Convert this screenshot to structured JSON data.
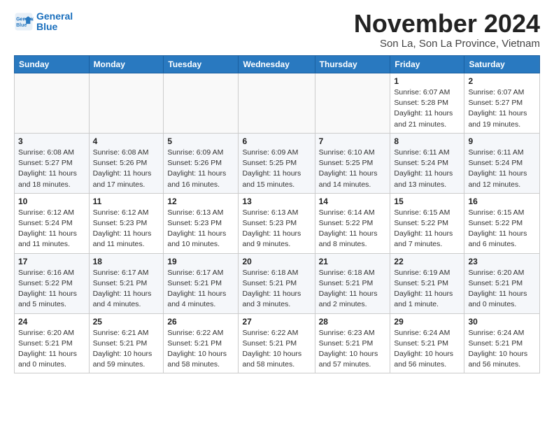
{
  "logo": {
    "line1": "General",
    "line2": "Blue"
  },
  "header": {
    "month": "November 2024",
    "location": "Son La, Son La Province, Vietnam"
  },
  "weekdays": [
    "Sunday",
    "Monday",
    "Tuesday",
    "Wednesday",
    "Thursday",
    "Friday",
    "Saturday"
  ],
  "weeks": [
    [
      {
        "day": "",
        "detail": ""
      },
      {
        "day": "",
        "detail": ""
      },
      {
        "day": "",
        "detail": ""
      },
      {
        "day": "",
        "detail": ""
      },
      {
        "day": "",
        "detail": ""
      },
      {
        "day": "1",
        "detail": "Sunrise: 6:07 AM\nSunset: 5:28 PM\nDaylight: 11 hours and 21 minutes."
      },
      {
        "day": "2",
        "detail": "Sunrise: 6:07 AM\nSunset: 5:27 PM\nDaylight: 11 hours and 19 minutes."
      }
    ],
    [
      {
        "day": "3",
        "detail": "Sunrise: 6:08 AM\nSunset: 5:27 PM\nDaylight: 11 hours and 18 minutes."
      },
      {
        "day": "4",
        "detail": "Sunrise: 6:08 AM\nSunset: 5:26 PM\nDaylight: 11 hours and 17 minutes."
      },
      {
        "day": "5",
        "detail": "Sunrise: 6:09 AM\nSunset: 5:26 PM\nDaylight: 11 hours and 16 minutes."
      },
      {
        "day": "6",
        "detail": "Sunrise: 6:09 AM\nSunset: 5:25 PM\nDaylight: 11 hours and 15 minutes."
      },
      {
        "day": "7",
        "detail": "Sunrise: 6:10 AM\nSunset: 5:25 PM\nDaylight: 11 hours and 14 minutes."
      },
      {
        "day": "8",
        "detail": "Sunrise: 6:11 AM\nSunset: 5:24 PM\nDaylight: 11 hours and 13 minutes."
      },
      {
        "day": "9",
        "detail": "Sunrise: 6:11 AM\nSunset: 5:24 PM\nDaylight: 11 hours and 12 minutes."
      }
    ],
    [
      {
        "day": "10",
        "detail": "Sunrise: 6:12 AM\nSunset: 5:24 PM\nDaylight: 11 hours and 11 minutes."
      },
      {
        "day": "11",
        "detail": "Sunrise: 6:12 AM\nSunset: 5:23 PM\nDaylight: 11 hours and 11 minutes."
      },
      {
        "day": "12",
        "detail": "Sunrise: 6:13 AM\nSunset: 5:23 PM\nDaylight: 11 hours and 10 minutes."
      },
      {
        "day": "13",
        "detail": "Sunrise: 6:13 AM\nSunset: 5:23 PM\nDaylight: 11 hours and 9 minutes."
      },
      {
        "day": "14",
        "detail": "Sunrise: 6:14 AM\nSunset: 5:22 PM\nDaylight: 11 hours and 8 minutes."
      },
      {
        "day": "15",
        "detail": "Sunrise: 6:15 AM\nSunset: 5:22 PM\nDaylight: 11 hours and 7 minutes."
      },
      {
        "day": "16",
        "detail": "Sunrise: 6:15 AM\nSunset: 5:22 PM\nDaylight: 11 hours and 6 minutes."
      }
    ],
    [
      {
        "day": "17",
        "detail": "Sunrise: 6:16 AM\nSunset: 5:22 PM\nDaylight: 11 hours and 5 minutes."
      },
      {
        "day": "18",
        "detail": "Sunrise: 6:17 AM\nSunset: 5:21 PM\nDaylight: 11 hours and 4 minutes."
      },
      {
        "day": "19",
        "detail": "Sunrise: 6:17 AM\nSunset: 5:21 PM\nDaylight: 11 hours and 4 minutes."
      },
      {
        "day": "20",
        "detail": "Sunrise: 6:18 AM\nSunset: 5:21 PM\nDaylight: 11 hours and 3 minutes."
      },
      {
        "day": "21",
        "detail": "Sunrise: 6:18 AM\nSunset: 5:21 PM\nDaylight: 11 hours and 2 minutes."
      },
      {
        "day": "22",
        "detail": "Sunrise: 6:19 AM\nSunset: 5:21 PM\nDaylight: 11 hours and 1 minute."
      },
      {
        "day": "23",
        "detail": "Sunrise: 6:20 AM\nSunset: 5:21 PM\nDaylight: 11 hours and 0 minutes."
      }
    ],
    [
      {
        "day": "24",
        "detail": "Sunrise: 6:20 AM\nSunset: 5:21 PM\nDaylight: 11 hours and 0 minutes."
      },
      {
        "day": "25",
        "detail": "Sunrise: 6:21 AM\nSunset: 5:21 PM\nDaylight: 10 hours and 59 minutes."
      },
      {
        "day": "26",
        "detail": "Sunrise: 6:22 AM\nSunset: 5:21 PM\nDaylight: 10 hours and 58 minutes."
      },
      {
        "day": "27",
        "detail": "Sunrise: 6:22 AM\nSunset: 5:21 PM\nDaylight: 10 hours and 58 minutes."
      },
      {
        "day": "28",
        "detail": "Sunrise: 6:23 AM\nSunset: 5:21 PM\nDaylight: 10 hours and 57 minutes."
      },
      {
        "day": "29",
        "detail": "Sunrise: 6:24 AM\nSunset: 5:21 PM\nDaylight: 10 hours and 56 minutes."
      },
      {
        "day": "30",
        "detail": "Sunrise: 6:24 AM\nSunset: 5:21 PM\nDaylight: 10 hours and 56 minutes."
      }
    ]
  ]
}
